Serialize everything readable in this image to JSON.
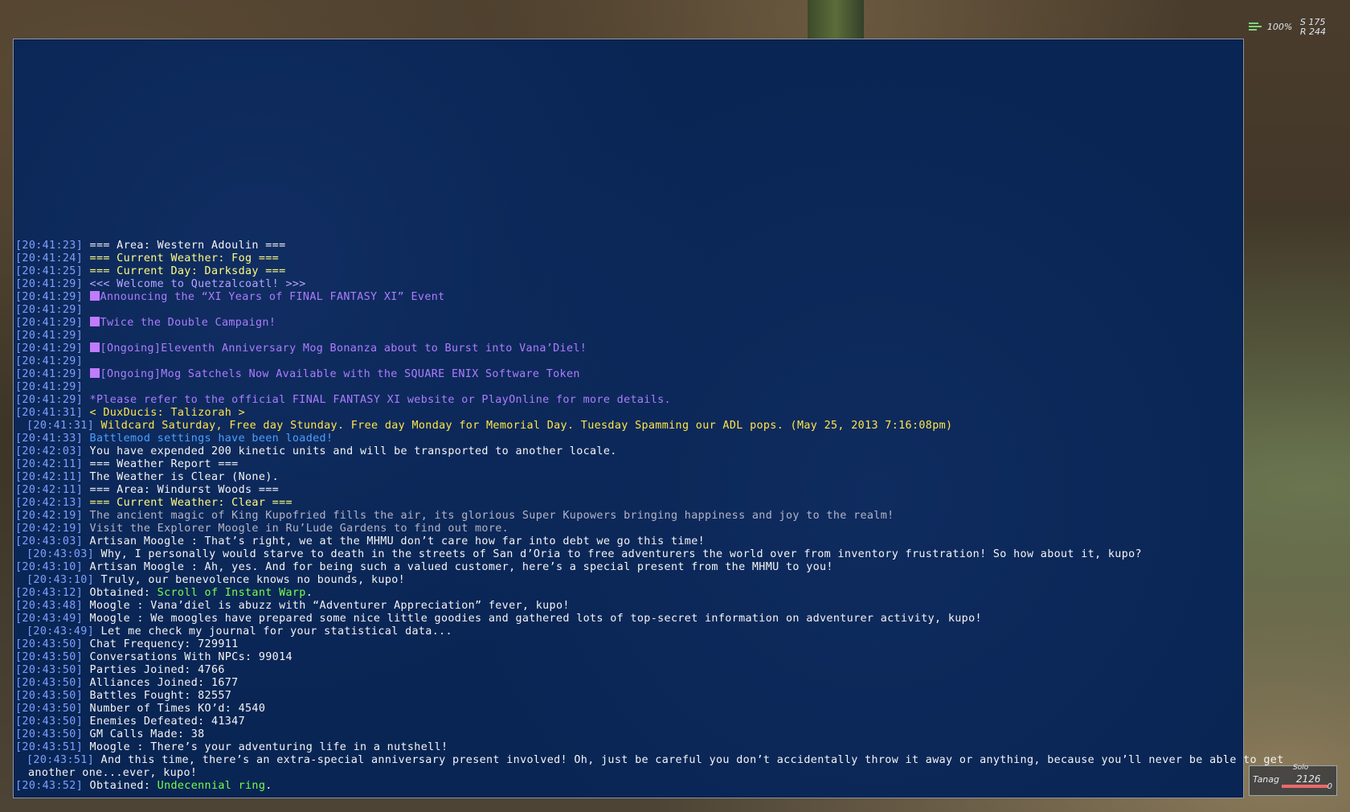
{
  "hud": {
    "signal_icon": "connection-bars-icon",
    "percent": "100%",
    "coord_s": "S 175",
    "coord_r": "R 244"
  },
  "chat": {
    "lines": [
      {
        "ts": "[20:41:23]",
        "segs": [
          {
            "t": " === Area: Western Adoulin ===",
            "c": "white"
          }
        ]
      },
      {
        "ts": "[20:41:24]",
        "segs": [
          {
            "t": " === Current Weather: Fog ===",
            "c": "yellow"
          }
        ]
      },
      {
        "ts": "[20:41:25]",
        "segs": [
          {
            "t": " === Current Day: Darksday ===",
            "c": "yellow"
          }
        ]
      },
      {
        "ts": "[20:41:29]",
        "segs": [
          {
            "t": " <<< Welcome to Quetzalcoatl! >>>",
            "c": "lav"
          }
        ]
      },
      {
        "ts": "[20:41:29]",
        "segs": [
          {
            "t": " ",
            "c": "purple"
          },
          {
            "sq": true
          },
          {
            "t": "Announcing the “XI Years of FINAL FANTASY XI” Event",
            "c": "purple"
          }
        ]
      },
      {
        "ts": "[20:41:29]",
        "segs": []
      },
      {
        "ts": "[20:41:29]",
        "segs": [
          {
            "t": " ",
            "c": "purple"
          },
          {
            "sq": true
          },
          {
            "t": "Twice the Double Campaign!",
            "c": "purple"
          }
        ]
      },
      {
        "ts": "[20:41:29]",
        "segs": []
      },
      {
        "ts": "[20:41:29]",
        "segs": [
          {
            "t": " ",
            "c": "purple"
          },
          {
            "sq": true
          },
          {
            "t": "[Ongoing]Eleventh Anniversary Mog Bonanza about to Burst into Vana’Diel!",
            "c": "purple"
          }
        ]
      },
      {
        "ts": "[20:41:29]",
        "segs": []
      },
      {
        "ts": "[20:41:29]",
        "segs": [
          {
            "t": " ",
            "c": "purple"
          },
          {
            "sq": true
          },
          {
            "t": "[Ongoing]Mog Satchels Now Available with the SQUARE ENIX Software Token",
            "c": "purple"
          }
        ]
      },
      {
        "ts": "[20:41:29]",
        "segs": []
      },
      {
        "ts": "[20:41:29]",
        "segs": [
          {
            "t": " *Please refer to the official FINAL FANTASY XI website or PlayOnline for more details.",
            "c": "purple"
          }
        ]
      },
      {
        "ts": "[20:41:31]",
        "segs": [
          {
            "t": " < DuxDucis: Talizorah >",
            "c": "gold"
          }
        ]
      },
      {
        "ts": "[20:41:31]",
        "cont": true,
        "segs": [
          {
            "t": " Wildcard Saturday, Free day Stunday. Free day Monday for Memorial Day. Tuesday Spamming our ADL pops. (May 25, 2013 7:16:08pm)",
            "c": "gold"
          }
        ]
      },
      {
        "ts": "[20:41:33]",
        "segs": [
          {
            "t": " Battlemod settings have been loaded!",
            "c": "blue"
          }
        ]
      },
      {
        "ts": "[20:42:03]",
        "segs": [
          {
            "t": " You have expended 200 kinetic units and will be transported to another locale.",
            "c": "white"
          }
        ]
      },
      {
        "ts": "[20:42:11]",
        "segs": [
          {
            "t": " === Weather Report ===",
            "c": "white"
          }
        ]
      },
      {
        "ts": "[20:42:11]",
        "segs": [
          {
            "t": " The Weather is Clear (None).",
            "c": "white"
          }
        ]
      },
      {
        "ts": "[20:42:11]",
        "segs": [
          {
            "t": " === Area: Windurst Woods ===",
            "c": "white"
          }
        ]
      },
      {
        "ts": "[20:42:13]",
        "segs": [
          {
            "t": " === Current Weather: Clear ===",
            "c": "yellow"
          }
        ]
      },
      {
        "ts": "[20:42:19]",
        "segs": [
          {
            "t": " The ancient magic of King Kupofried fills the air, its glorious Super Kupowers bringing happiness and joy to the realm!",
            "c": "grey"
          }
        ]
      },
      {
        "ts": "[20:42:19]",
        "segs": [
          {
            "t": " Visit the Explorer Moogle in Ru’Lude Gardens to find out more.",
            "c": "grey"
          }
        ]
      },
      {
        "ts": "[20:43:03]",
        "segs": [
          {
            "t": " Artisan Moogle : That’s right, we at the MHMU don’t care how far into debt we go this time!",
            "c": "white"
          }
        ]
      },
      {
        "ts": "[20:43:03]",
        "cont": true,
        "segs": [
          {
            "t": " Why, I personally would starve to death in the streets of San d’Oria to free adventurers the world over from inventory frustration! So how about it, kupo?",
            "c": "white"
          }
        ]
      },
      {
        "ts": "[20:43:10]",
        "segs": [
          {
            "t": " Artisan Moogle : Ah, yes. And for being such a valued customer, here’s a special present from the MHMU to you!",
            "c": "white"
          }
        ]
      },
      {
        "ts": "[20:43:10]",
        "cont": true,
        "segs": [
          {
            "t": " Truly, our benevolence knows no bounds, kupo!",
            "c": "white"
          }
        ]
      },
      {
        "ts": "[20:43:12]",
        "segs": [
          {
            "t": " Obtained: ",
            "c": "white"
          },
          {
            "t": "Scroll of Instant Warp",
            "c": "green"
          },
          {
            "t": ".",
            "c": "white"
          }
        ]
      },
      {
        "ts": "[20:43:48]",
        "segs": [
          {
            "t": " Moogle : Vana’diel is abuzz with “Adventurer Appreciation” fever, kupo!",
            "c": "white"
          }
        ]
      },
      {
        "ts": "[20:43:49]",
        "segs": [
          {
            "t": " Moogle : We moogles have prepared some nice little goodies and gathered lots of top-secret information on adventurer activity, kupo!",
            "c": "white"
          }
        ]
      },
      {
        "ts": "[20:43:49]",
        "cont": true,
        "segs": [
          {
            "t": " Let me check my journal for your statistical data...",
            "c": "white"
          }
        ]
      },
      {
        "ts": "[20:43:50]",
        "segs": [
          {
            "t": " Chat Frequency: 729911",
            "c": "white"
          }
        ]
      },
      {
        "ts": "[20:43:50]",
        "segs": [
          {
            "t": " Conversations With NPCs: 99014",
            "c": "white"
          }
        ]
      },
      {
        "ts": "[20:43:50]",
        "segs": [
          {
            "t": " Parties Joined: 4766",
            "c": "white"
          }
        ]
      },
      {
        "ts": "[20:43:50]",
        "segs": [
          {
            "t": " Alliances Joined: 1677",
            "c": "white"
          }
        ]
      },
      {
        "ts": "[20:43:50]",
        "segs": [
          {
            "t": " Battles Fought: 82557",
            "c": "white"
          }
        ]
      },
      {
        "ts": "[20:43:50]",
        "segs": [
          {
            "t": " Number of Times KO’d: 4540",
            "c": "white"
          }
        ]
      },
      {
        "ts": "[20:43:50]",
        "segs": [
          {
            "t": " Enemies Defeated: 41347",
            "c": "white"
          }
        ]
      },
      {
        "ts": "[20:43:50]",
        "segs": [
          {
            "t": " GM Calls Made: 38",
            "c": "white"
          }
        ]
      },
      {
        "ts": "[20:43:51]",
        "segs": [
          {
            "t": " Moogle : There’s your adventuring life in a nutshell!",
            "c": "white"
          }
        ]
      },
      {
        "ts": "[20:43:51]",
        "cont": true,
        "segs": [
          {
            "t": " And this time, there’s an extra-special anniversary present involved! Oh, just be careful you don’t accidentally throw it away or anything, because you’ll never be able to get",
            "c": "white"
          }
        ]
      },
      {
        "ts": "",
        "wrap": true,
        "segs": [
          {
            "t": "another one...ever, kupo!",
            "c": "white"
          }
        ]
      },
      {
        "ts": "[20:43:52]",
        "segs": [
          {
            "t": " Obtained: ",
            "c": "white"
          },
          {
            "t": "Undecennial ring",
            "c": "green"
          },
          {
            "t": ".",
            "c": "white"
          }
        ]
      }
    ]
  },
  "status": {
    "mode": "Solo",
    "name": "Tanag",
    "hp": "2126",
    "hp_fraction": 0.95,
    "tp": "0"
  }
}
